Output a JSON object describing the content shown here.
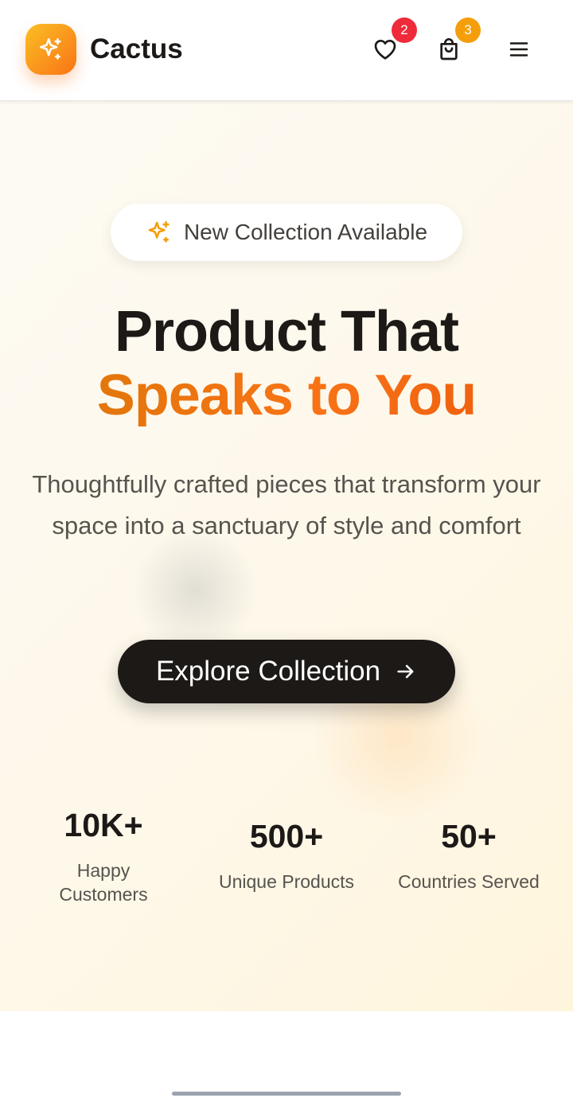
{
  "header": {
    "brand": "Cactus",
    "logo_icon": "sparkles-icon",
    "wishlist_count": "2",
    "cart_count": "3",
    "icons": [
      "heart-icon",
      "shopping-bag-icon",
      "menu-icon"
    ]
  },
  "hero": {
    "pill_icon": "sparkles-icon",
    "pill_text": "New Collection Available",
    "headline_line1": "Product That",
    "headline_line2": "Speaks to You",
    "subtitle": "Thoughtfully crafted pieces that transform your space into a sanctuary of style and comfort",
    "cta_label": "Explore Collection",
    "cta_icon": "arrow-right-icon"
  },
  "stats": [
    {
      "value": "10K+",
      "label": "Happy Customers"
    },
    {
      "value": "500+",
      "label": "Unique Products"
    },
    {
      "value": "50+",
      "label": "Countries Served"
    }
  ],
  "colors": {
    "brand_gradient_start": "#fbbf24",
    "brand_gradient_end": "#f97316",
    "text_dark": "#1c1917",
    "wishlist_badge": "#ef2b3b",
    "cart_badge": "#f59e0b",
    "hero_background": "#fef8ea"
  }
}
